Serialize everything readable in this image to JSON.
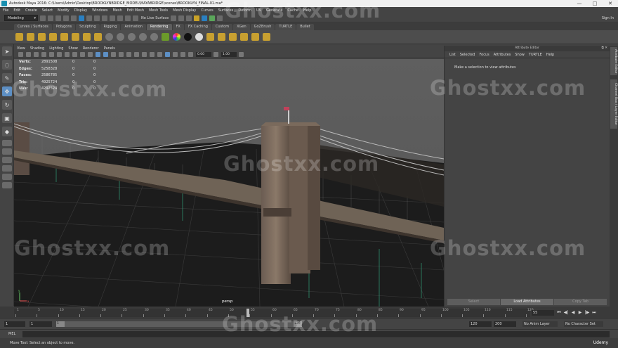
{
  "window": {
    "title": "Autodesk Maya 2016: C:\\Users\\Admin\\Desktop\\BROOKLYNBRIDGE_MODEL\\MAYABRIDGE\\scenes\\BROOKLYN_FINAL-01.ma*",
    "minimize": "—",
    "maximize": "□",
    "close": "✕"
  },
  "menus": [
    "File",
    "Edit",
    "Create",
    "Select",
    "Modify",
    "Display",
    "Windows",
    "Mesh",
    "Edit Mesh",
    "Mesh Tools",
    "Mesh Display",
    "Curves",
    "Surfaces",
    "Deform",
    "UV",
    "Generate",
    "Cache",
    "Help"
  ],
  "status": {
    "mode": "Modeling",
    "live_surface": "No Live Surface",
    "sign_in": "Sign In"
  },
  "shelf_tabs": [
    "Curves / Surfaces",
    "Polygons",
    "Sculpting",
    "Rigging",
    "Animation",
    "Rendering",
    "FX",
    "FX Caching",
    "Custom",
    "XGen",
    "GoZBrush",
    "TURTLE",
    "Bullet"
  ],
  "active_shelf_tab": "Rendering",
  "viewport": {
    "menus": [
      "View",
      "Shading",
      "Lighting",
      "Show",
      "Renderer",
      "Panels"
    ],
    "field_a": "0.00",
    "field_b": "1.00",
    "camera": "persp",
    "hud": [
      {
        "label": "Verts:",
        "value": "2891508",
        "c1": "0",
        "c2": "0"
      },
      {
        "label": "Edges:",
        "value": "5258328",
        "c1": "0",
        "c2": "0"
      },
      {
        "label": "Faces:",
        "value": "2586785",
        "c1": "0",
        "c2": "0"
      },
      {
        "label": "Tris:",
        "value": "4925724",
        "c1": "0",
        "c2": "0"
      },
      {
        "label": "UVs:",
        "value": "4292524",
        "c1": "0",
        "c2": "0"
      }
    ],
    "axis_x": "x",
    "axis_y": "y"
  },
  "attribute_editor": {
    "title": "Attribute Editor",
    "menus": [
      "List",
      "Selected",
      "Focus",
      "Attributes",
      "Show",
      "TURTLE",
      "Help"
    ],
    "message": "Make a selection to view attributes",
    "buttons": [
      "Select",
      "Load Attributes",
      "Copy Tab"
    ]
  },
  "side_tabs": [
    "Attribute Editor",
    "Channel Box / Layer Editor"
  ],
  "timeline": {
    "ticks": [
      "1",
      "5",
      "10",
      "15",
      "20",
      "25",
      "30",
      "35",
      "40",
      "45",
      "50",
      "55",
      "60",
      "65",
      "70",
      "75",
      "80",
      "85",
      "90",
      "95",
      "100",
      "105",
      "110",
      "115",
      "120"
    ],
    "current_frame": "55",
    "playback_icons": [
      "⏮",
      "◀|",
      "◀",
      "▶",
      "|▶",
      "⏭"
    ]
  },
  "range": {
    "start": "1",
    "start_inner": "1",
    "bar_start": "1",
    "bar_end": "120",
    "end_inner": "120",
    "end": "200",
    "anim_layer": "No Anim Layer",
    "character_set": "No Character Set"
  },
  "command_line": {
    "label": "MEL"
  },
  "help_line": {
    "text": "Move Tool: Select an object to move.",
    "badge": "Udemy"
  },
  "watermark": "Ghostxx.com"
}
